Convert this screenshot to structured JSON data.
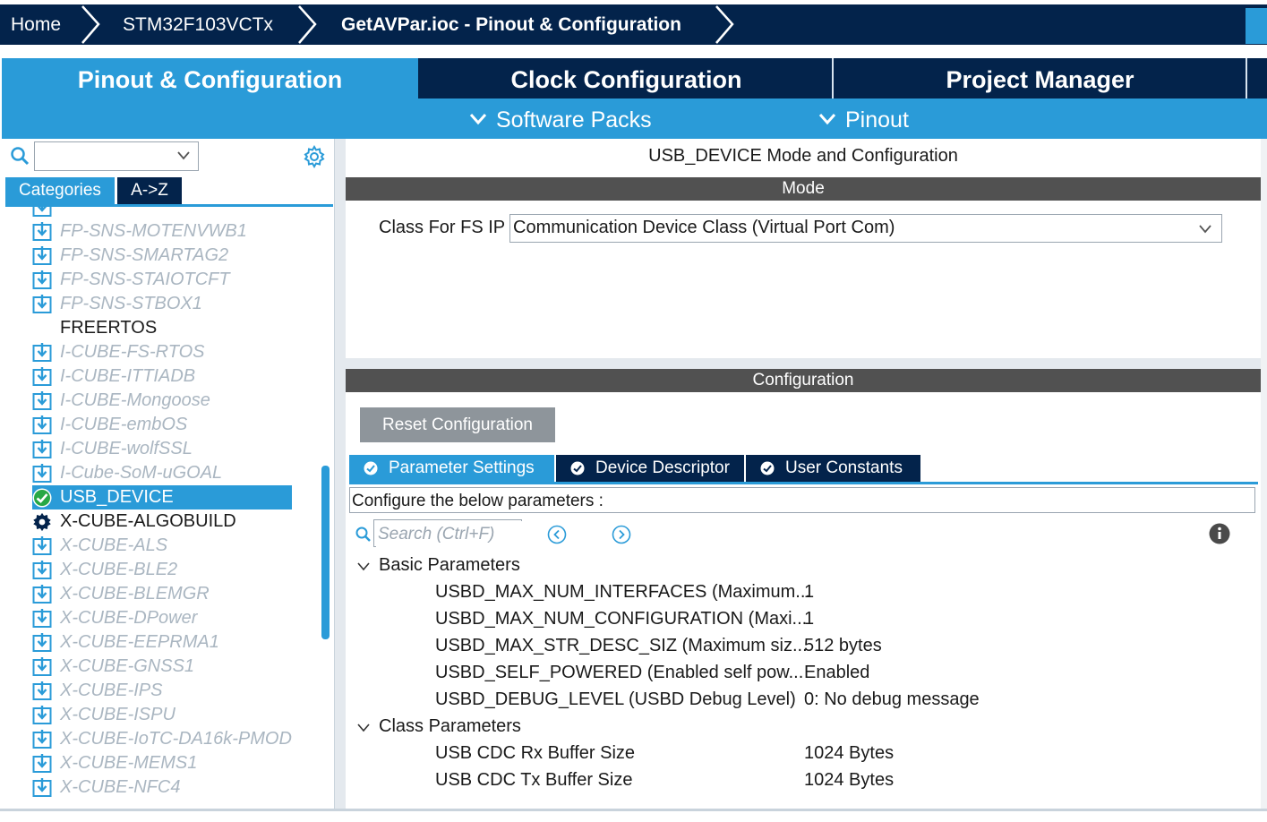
{
  "breadcrumb": {
    "home": "Home",
    "device": "STM32F103VCTx",
    "file": "GetAVPar.ioc - Pinout & Configuration"
  },
  "main_tabs": {
    "pinout": "Pinout & Configuration",
    "clock": "Clock Configuration",
    "project": "Project Manager"
  },
  "sub_menu": {
    "software_packs": "Software Packs",
    "pinout": "Pinout"
  },
  "left": {
    "category_tabs": [
      "Categories",
      "A->Z"
    ],
    "tree": [
      {
        "label": "FP-SNS-MOTENVWB1",
        "state": "dim",
        "icon": "download-icon"
      },
      {
        "label": "FP-SNS-SMARTAG2",
        "state": "dim",
        "icon": "download-icon"
      },
      {
        "label": "FP-SNS-STAIOTCFT",
        "state": "dim",
        "icon": "download-icon"
      },
      {
        "label": "FP-SNS-STBOX1",
        "state": "dim",
        "icon": "download-icon"
      },
      {
        "label": "FREERTOS",
        "state": "normal",
        "icon": "none"
      },
      {
        "label": "I-CUBE-FS-RTOS",
        "state": "dim",
        "icon": "download-icon"
      },
      {
        "label": "I-CUBE-ITTIADB",
        "state": "dim",
        "icon": "download-icon"
      },
      {
        "label": "I-CUBE-Mongoose",
        "state": "dim",
        "icon": "download-icon"
      },
      {
        "label": "I-CUBE-embOS",
        "state": "dim",
        "icon": "download-icon"
      },
      {
        "label": "I-CUBE-wolfSSL",
        "state": "dim",
        "icon": "download-icon"
      },
      {
        "label": "I-Cube-SoM-uGOAL",
        "state": "dim",
        "icon": "download-icon"
      },
      {
        "label": "USB_DEVICE",
        "state": "selected",
        "icon": "check-circle-icon"
      },
      {
        "label": "X-CUBE-ALGOBUILD",
        "state": "normal",
        "icon": "gear-icon"
      },
      {
        "label": "X-CUBE-ALS",
        "state": "dim",
        "icon": "download-icon"
      },
      {
        "label": "X-CUBE-BLE2",
        "state": "dim",
        "icon": "download-icon"
      },
      {
        "label": "X-CUBE-BLEMGR",
        "state": "dim",
        "icon": "download-icon"
      },
      {
        "label": "X-CUBE-DPower",
        "state": "dim",
        "icon": "download-icon"
      },
      {
        "label": "X-CUBE-EEPRMA1",
        "state": "dim",
        "icon": "download-icon"
      },
      {
        "label": "X-CUBE-GNSS1",
        "state": "dim",
        "icon": "download-icon"
      },
      {
        "label": "X-CUBE-IPS",
        "state": "dim",
        "icon": "download-icon"
      },
      {
        "label": "X-CUBE-ISPU",
        "state": "dim",
        "icon": "download-icon"
      },
      {
        "label": "X-CUBE-IoTC-DA16k-PMOD",
        "state": "dim",
        "icon": "download-icon"
      },
      {
        "label": "X-CUBE-MEMS1",
        "state": "dim",
        "icon": "download-icon"
      },
      {
        "label": "X-CUBE-NFC4",
        "state": "dim",
        "icon": "download-icon"
      }
    ]
  },
  "right": {
    "title": "USB_DEVICE Mode and Configuration",
    "mode_header": "Mode",
    "mode_label": "Class For FS IP",
    "mode_value": "Communication Device Class (Virtual Port Com)",
    "config_header": "Configuration",
    "reset_button": "Reset Configuration",
    "tabs": [
      "Parameter Settings",
      "Device Descriptor",
      "User Constants"
    ],
    "note": "Configure the below parameters :",
    "search_placeholder": "Search (Ctrl+F)",
    "groups": [
      {
        "name": "Basic Parameters",
        "params": [
          {
            "name": "USBD_MAX_NUM_INTERFACES (Maximum...",
            "value": "1"
          },
          {
            "name": "USBD_MAX_NUM_CONFIGURATION (Maxi...",
            "value": "1"
          },
          {
            "name": "USBD_MAX_STR_DESC_SIZ (Maximum siz...",
            "value": "512 bytes"
          },
          {
            "name": "USBD_SELF_POWERED (Enabled self pow...",
            "value": "Enabled"
          },
          {
            "name": "USBD_DEBUG_LEVEL (USBD Debug Level)",
            "value": "0: No debug message"
          }
        ]
      },
      {
        "name": "Class Parameters",
        "params": [
          {
            "name": "USB CDC Rx Buffer Size",
            "value": "1024 Bytes"
          },
          {
            "name": "USB CDC Tx Buffer Size",
            "value": "1024 Bytes"
          }
        ]
      }
    ]
  },
  "colors": {
    "navy": "#03234b",
    "accent": "#2a9bd8",
    "header_gray": "#515151",
    "dim_text": "#aab6c1"
  }
}
